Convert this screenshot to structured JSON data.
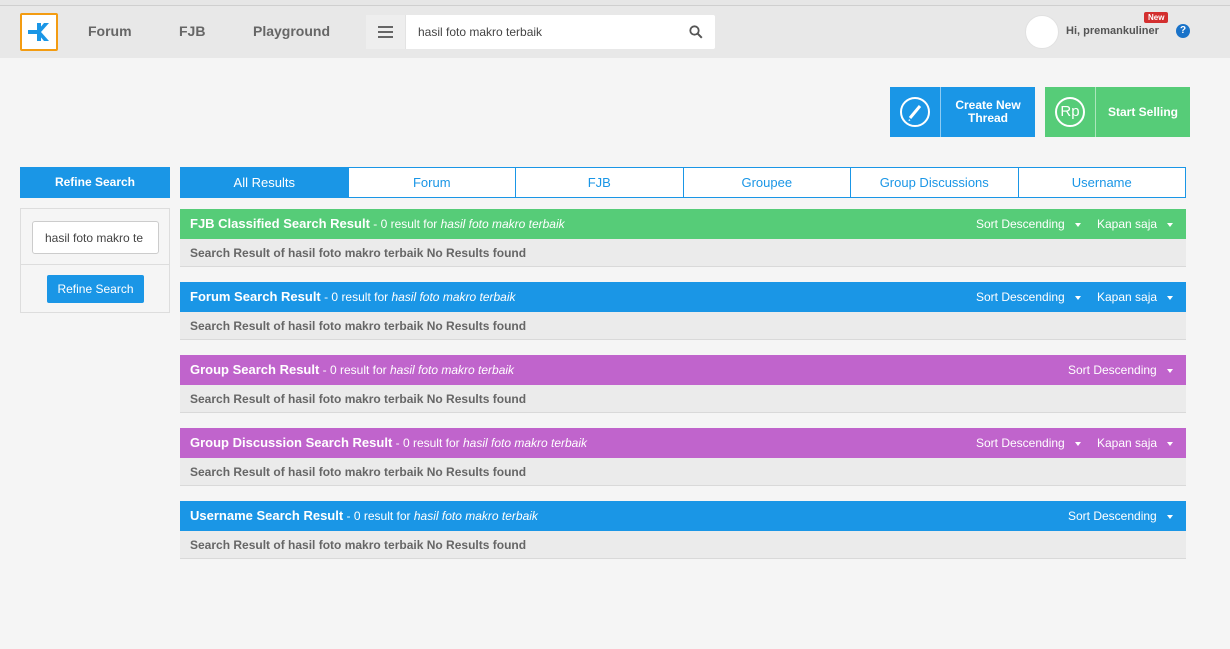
{
  "nav": {
    "forum": "Forum",
    "fjb": "FJB",
    "playground": "Playground"
  },
  "search": {
    "query": "hasil foto makro terbaik"
  },
  "user": {
    "greeting": "Hi, premankuliner",
    "badge": "New",
    "help": "?"
  },
  "actions": {
    "create_thread": "Create New Thread",
    "start_selling": "Start Selling",
    "rp_symbol": "Rp"
  },
  "refine": {
    "title": "Refine Search",
    "input_value": "hasil foto makro te",
    "button": "Refine Search"
  },
  "tabs": [
    "All Results",
    "Forum",
    "FJB",
    "Groupee",
    "Group Discussions",
    "Username"
  ],
  "sections": [
    {
      "title": "FJB Classified Search Result",
      "count_text": " - 0 result for ",
      "query": "hasil foto makro terbaik",
      "sort": "Sort Descending",
      "time": "Kapan saja",
      "body": "Search Result of hasil foto makro terbaik No Results found",
      "color": "#56cc78"
    },
    {
      "title": "Forum Search Result",
      "count_text": " - 0 result for ",
      "query": "hasil foto makro terbaik",
      "sort": "Sort Descending",
      "time": "Kapan saja",
      "body": "Search Result of hasil foto makro terbaik No Results found",
      "color": "#1a96e6"
    },
    {
      "title": "Group Search Result",
      "count_text": " - 0 result for ",
      "query": "hasil foto makro terbaik",
      "sort": "Sort Descending",
      "time": "",
      "body": "Search Result of hasil foto makro terbaik No Results found",
      "color": "#c064cc"
    },
    {
      "title": "Group Discussion Search Result",
      "count_text": " - 0 result for ",
      "query": "hasil foto makro terbaik",
      "sort": "Sort Descending",
      "time": "Kapan saja",
      "body": "Search Result of hasil foto makro terbaik No Results found",
      "color": "#c064cc"
    },
    {
      "title": "Username Search Result",
      "count_text": " - 0 result for ",
      "query": "hasil foto makro terbaik",
      "sort": "Sort Descending",
      "time": "",
      "body": "Search Result of hasil foto makro terbaik No Results found",
      "color": "#1a96e6"
    }
  ],
  "colors": {
    "primary": "#1a96e6",
    "green": "#56cc78",
    "purple": "#c064cc",
    "logo_border": "#f39c12",
    "badge": "#d32f2f"
  }
}
